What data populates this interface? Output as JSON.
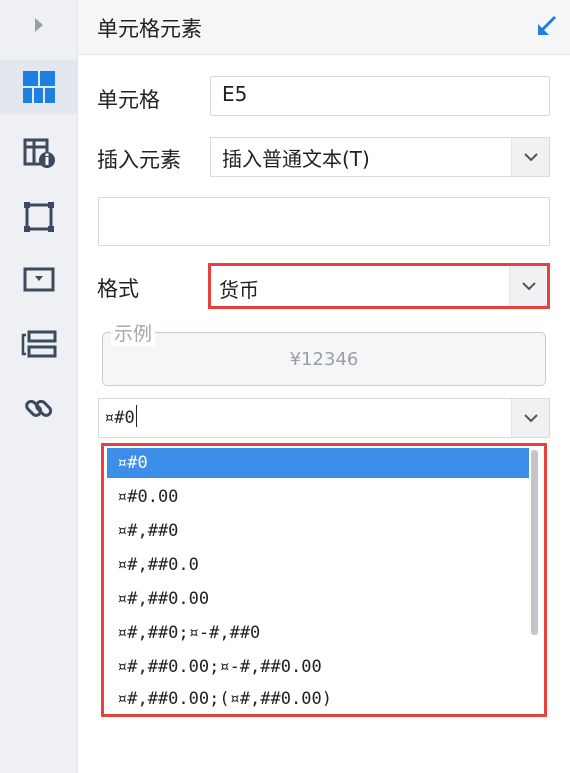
{
  "panel": {
    "title": "单元格元素"
  },
  "sidebar": {
    "items": [
      {
        "icon": "expand-arrow-icon"
      },
      {
        "icon": "cell-element-icon",
        "active": true
      },
      {
        "icon": "cell-attribute-icon"
      },
      {
        "icon": "widget-icon"
      },
      {
        "icon": "parameter-icon"
      },
      {
        "icon": "list-layout-icon"
      },
      {
        "icon": "hyperlink-icon"
      }
    ]
  },
  "form": {
    "cell_label": "单元格",
    "cell_value": "E5",
    "insert_label": "插入元素",
    "insert_value": "插入普通文本(T)",
    "text_value": "",
    "format_label": "格式",
    "format_value": "货币",
    "example_label": "示例",
    "example_value": "¥12346",
    "pattern_value": "¤#0"
  },
  "pattern_options": [
    "¤#0",
    "¤#0.00",
    "¤#,##0",
    "¤#,##0.0",
    "¤#,##0.00",
    "¤#,##0;¤-#,##0",
    "¤#,##0.00;¤-#,##0.00",
    "¤#,##0.00;(¤#,##0.00)"
  ],
  "selected_option_index": 0,
  "colors": {
    "accent": "#3d8ee8",
    "highlight_border": "#e8413d",
    "icon": "#3b4a5c"
  }
}
